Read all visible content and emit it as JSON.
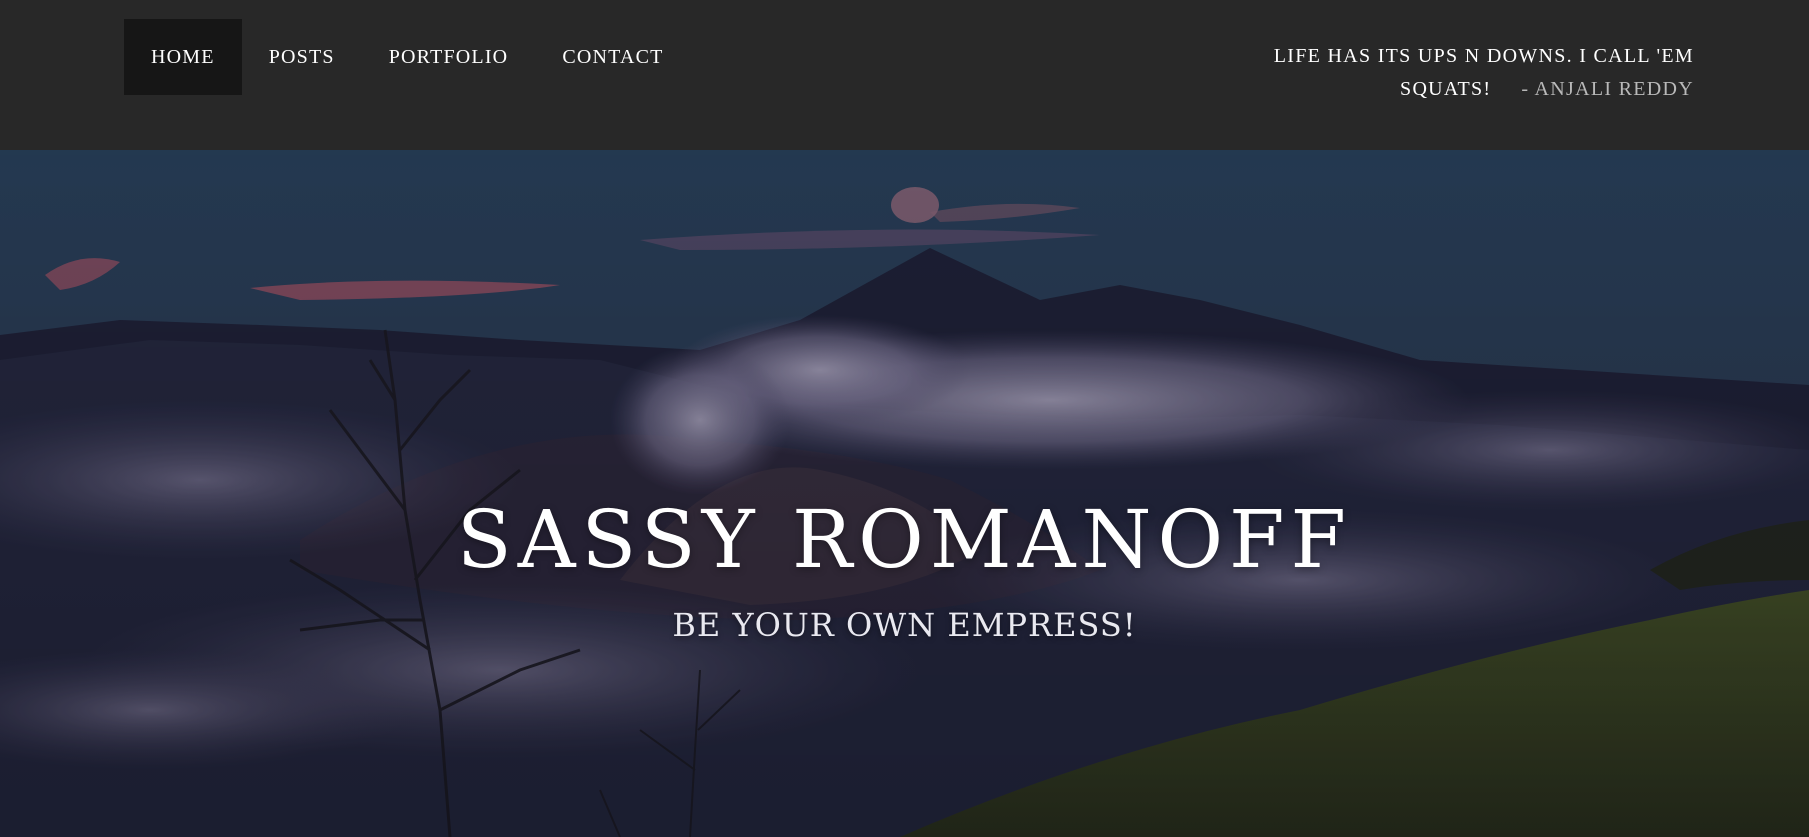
{
  "nav": {
    "items": [
      {
        "label": "HOME",
        "active": true
      },
      {
        "label": "POSTS",
        "active": false
      },
      {
        "label": "PORTFOLIO",
        "active": false
      },
      {
        "label": "CONTACT",
        "active": false
      }
    ]
  },
  "quote": {
    "text": "LIFE HAS ITS UPS N DOWNS. I CALL 'EM SQUATS!",
    "author": "- ANJALI REDDY"
  },
  "hero": {
    "title": "SASSY ROMANOFF",
    "subtitle": "BE YOUR OWN EMPRESS!",
    "image": "volcano-landscape-background"
  },
  "colors": {
    "topbar": "#282828",
    "active_nav": "#161616",
    "nav_text": "#ffffff",
    "quote_author": "#b9b9b9"
  }
}
